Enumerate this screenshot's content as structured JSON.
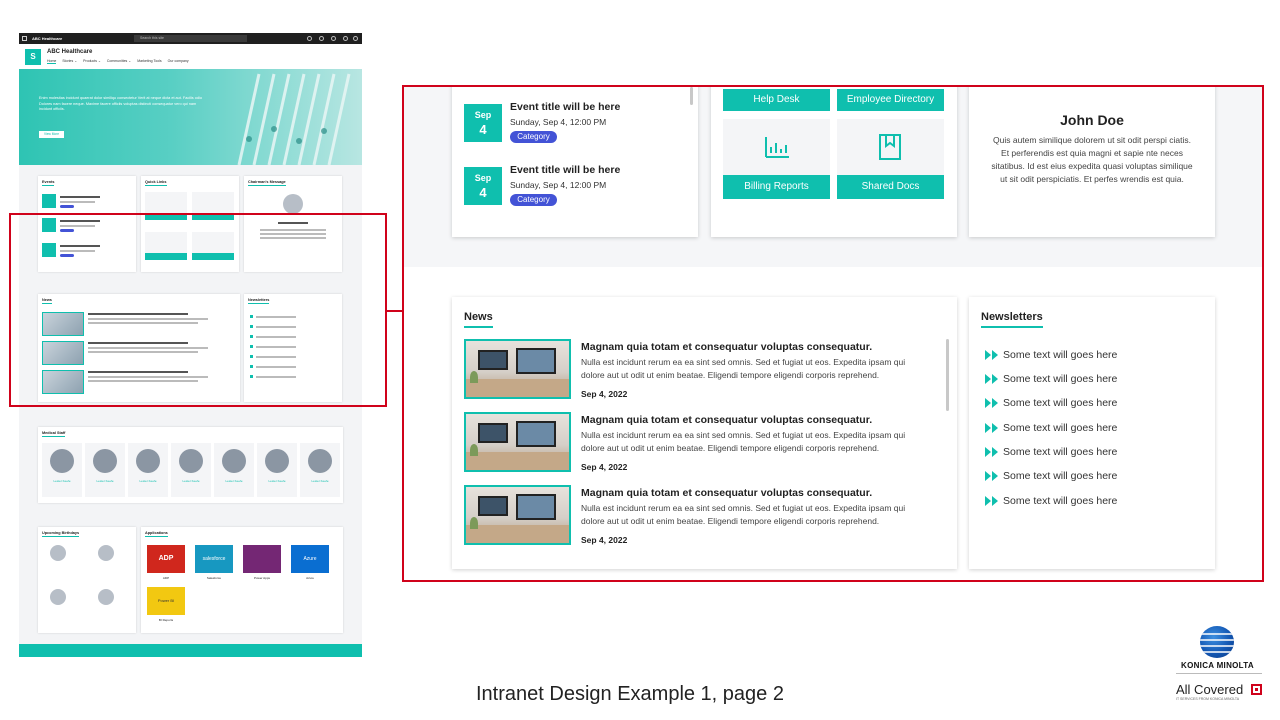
{
  "thumbnail": {
    "suite_title": "ABC Healthcare",
    "search_placeholder": "Search this site",
    "site_logo_letter": "S",
    "site_title": "ABC Healthcare",
    "nav": [
      "Home",
      "Stories ⌄",
      "Products ⌄",
      "Communities ⌄",
      "Marketing Tools",
      "Our company"
    ],
    "hero_text": "Enim molestias incidunt quaerat dolor similiqu consectetur Verit at neque dicta et aut. Facilis odio Dolores nam facere neque. Maxime facere officiis voluptas distincti consequatur vero qui nam incidunt officiis.",
    "hero_button": "View More",
    "events_title": "Events",
    "quick_links_title": "Quick Links",
    "chairman_title": "Chairman's Message",
    "news_title": "News",
    "newsletters_title": "Newsletters",
    "medical_staff_title": "Medical Staff",
    "staff_name": "Lester Keefe",
    "birthdays_title": "Upcoming Birthdays",
    "applications_title": "Applications",
    "apps": [
      {
        "label": "ADP",
        "logo": "ADP",
        "color": "#d0271d"
      },
      {
        "label": "Salesforce",
        "logo": "salesforce",
        "color": "#1798c1"
      },
      {
        "label": "Power Apps",
        "logo": "",
        "color": "#742774"
      },
      {
        "label": "Azure",
        "logo": "Azure",
        "color": "#0a6ed1"
      },
      {
        "label": "BI Reports",
        "logo": "Power BI",
        "color": "#f2c811"
      }
    ]
  },
  "events": [
    {
      "month": "Sep",
      "day": "4",
      "title": "Event title will be here",
      "when": "Sunday, Sep 4, 12:00 PM",
      "category": "Category"
    },
    {
      "month": "Sep",
      "day": "4",
      "title": "Event title will be here",
      "when": "Sunday, Sep 4, 12:00 PM",
      "category": "Category"
    }
  ],
  "quick_links": [
    {
      "label": "Help Desk",
      "icon": "phone-icon"
    },
    {
      "label": "Employee Directory",
      "icon": "org-chart-icon"
    },
    {
      "label": "Billing Reports",
      "icon": "bar-chart-icon"
    },
    {
      "label": "Shared Docs",
      "icon": "document-icon"
    }
  ],
  "chairman": {
    "name": "John Doe",
    "message": "Quis autem similique dolorem ut sit odit perspi ciatis. Et perferendis est quia magni et sapie nte neces sitatibus. Id est eius expedita quasi voluptas similique ut sit odit perspiciatis. Et perfes wrendis est quia."
  },
  "news": {
    "title": "News",
    "items": [
      {
        "headline": "Magnam quia totam et consequatur voluptas consequatur.",
        "body": "Nulla est incidunt rerum ea ea sint sed omnis. Sed et fugiat ut eos. Expedita ipsam qui dolore aut ut odit ut enim beatae. Eligendi tempore eligendi corporis reprehend.",
        "date": "Sep 4, 2022"
      },
      {
        "headline": "Magnam quia totam et consequatur voluptas consequatur.",
        "body": "Nulla est incidunt rerum ea ea sint sed omnis. Sed et fugiat ut eos. Expedita ipsam qui dolore aut ut odit ut enim beatae. Eligendi tempore eligendi corporis reprehend.",
        "date": "Sep 4, 2022"
      },
      {
        "headline": "Magnam quia totam et consequatur voluptas consequatur.",
        "body": "Nulla est incidunt rerum ea ea sint sed omnis. Sed et fugiat ut eos. Expedita ipsam qui dolore aut ut odit ut enim beatae. Eligendi tempore eligendi corporis reprehend.",
        "date": "Sep 4, 2022"
      }
    ]
  },
  "newsletters": {
    "title": "Newsletters",
    "items": [
      "Some text will goes here",
      "Some text will goes here",
      "Some text will goes here",
      "Some text will goes here",
      "Some text will goes here",
      "Some text will goes here",
      "Some text will goes here"
    ]
  },
  "caption": "Intranet Design Example 1, page 2",
  "branding": {
    "konica": "KONICA MINOLTA",
    "all_covered": "All Covered",
    "tagline": "IT SERVICES FROM KONICA MINOLTA"
  },
  "colors": {
    "accent": "#0fbfae",
    "category": "#4353d6",
    "highlight": "#d0021b"
  }
}
